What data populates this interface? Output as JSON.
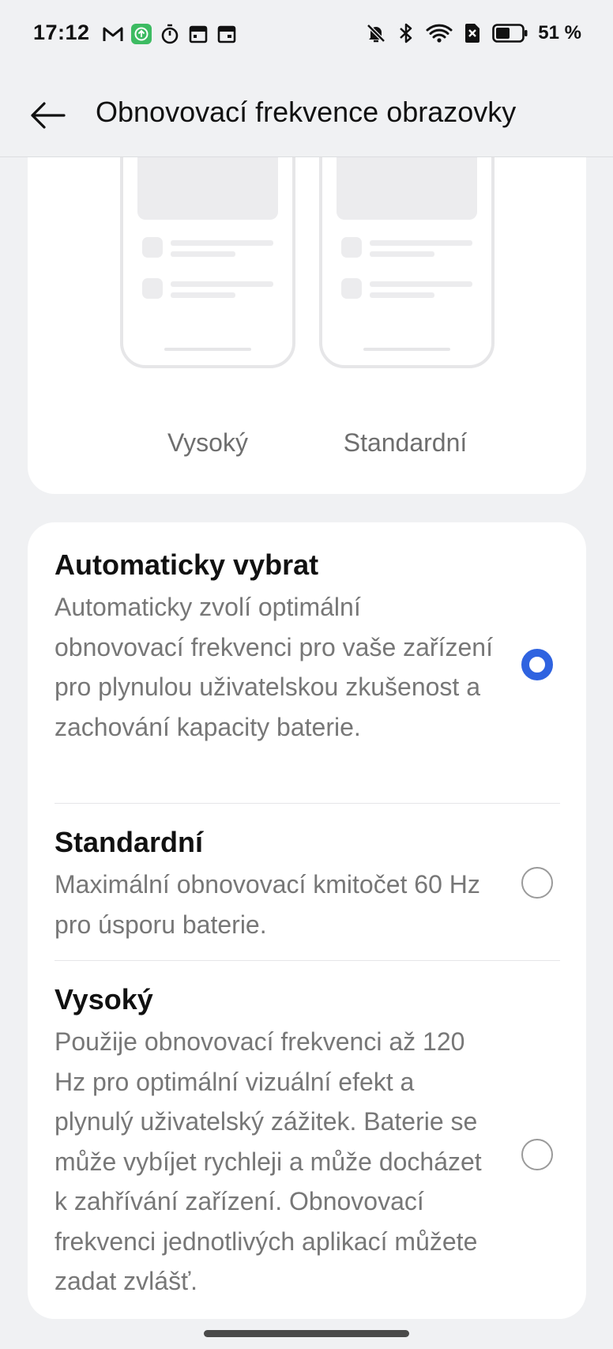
{
  "status_bar": {
    "time": "17:12",
    "battery": "51 %",
    "left_icons": [
      "gmail-icon",
      "app-update-icon",
      "timer-icon",
      "calendar-icon",
      "calendar-alt-icon"
    ],
    "right_icons": [
      "mute-icon",
      "bluetooth-icon",
      "wifi-icon",
      "no-sim-icon",
      "battery-icon"
    ]
  },
  "header": {
    "title": "Obnovovací frekvence obrazovky"
  },
  "preview": {
    "left_label": "Vysoký",
    "right_label": "Standardní"
  },
  "options": [
    {
      "title": "Automaticky vybrat",
      "description": "Automaticky zvolí optimální obnovovací frekvenci pro vaše zařízení pro plynulou uživatelskou zkušenost a zachování kapacity baterie.",
      "selected": true
    },
    {
      "title": "Standardní",
      "description": "Maximální obnovovací kmitočet 60 Hz pro úsporu baterie.",
      "selected": false
    },
    {
      "title": "Vysoký",
      "description": "Použije obnovovací frekvenci až 120 Hz pro optimální vizuální efekt a plynulý uživatelský zážitek. Baterie se může vybíjet rychleji a může docházet k zahřívání zařízení. Obnovovací frekvenci jednotlivých aplikací můžete zadat zvlášť.",
      "selected": false
    }
  ],
  "colors": {
    "accent": "#2f63e0",
    "background": "#f0f1f3",
    "card": "#ffffff",
    "secondary_text": "#777777"
  }
}
